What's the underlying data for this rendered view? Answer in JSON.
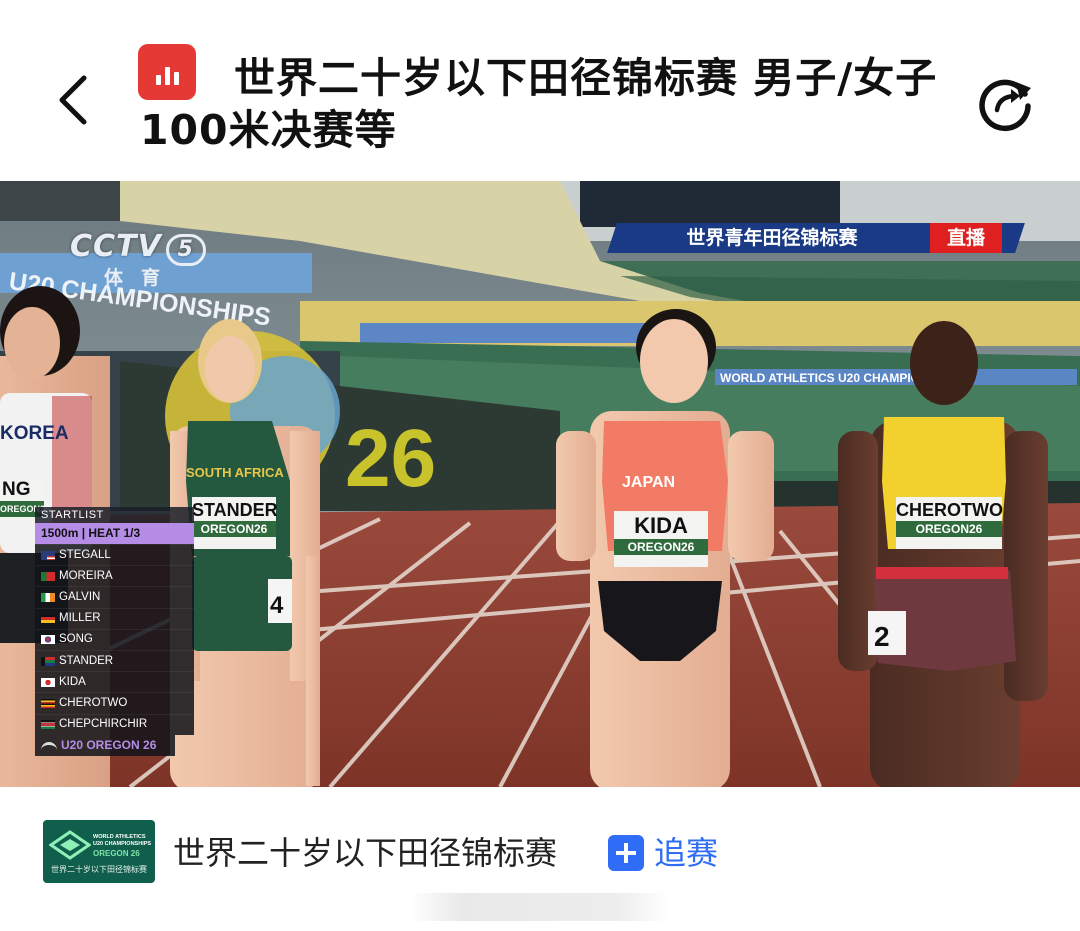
{
  "header": {
    "back_icon": "chevron-left-icon",
    "app_icon": "bar-chart-icon",
    "app_icon_color": "#e53935",
    "title": "世界二十岁以下田径锦标赛 男子/女子100米决赛等",
    "refresh_icon": "refresh-icon"
  },
  "video": {
    "broadcaster_logo": "CCTV",
    "channel_number": "5",
    "channel_name": "体育",
    "banner_text": "世界青年田径锦标赛",
    "live_badge": "直播",
    "banner_color": "#1a3a86",
    "live_color": "#e02020",
    "stadium_sign_left": "U20 CHAMPIONSHIPS",
    "stadium_sign_right": "WORLD ATHLETICS U20 CHAMPIONSHIPS",
    "stadium_number": "26",
    "athletes": [
      {
        "bib_name": "NG",
        "bib_sub": "OREGON26",
        "shirt_text": "KOREA"
      },
      {
        "bib_name": "STANDER",
        "bib_sub": "OREGON26",
        "shirt_text": "SOUTH AFRICA"
      },
      {
        "bib_name": "KIDA",
        "bib_sub": "OREGON26",
        "shirt_text": "JAPAN"
      },
      {
        "bib_name": "CHEROTWO",
        "bib_sub": "OREGON26",
        "shirt_text": ""
      }
    ],
    "hip_numbers": [
      "4",
      "2"
    ],
    "startlist": {
      "header": "STARTLIST",
      "heat": "1500m | HEAT 1/3",
      "entries": [
        {
          "name": "STEGALL",
          "flag": "usa"
        },
        {
          "name": "MOREIRA",
          "flag": "portugal"
        },
        {
          "name": "GALVIN",
          "flag": "ireland"
        },
        {
          "name": "MILLER",
          "flag": "germany"
        },
        {
          "name": "SONG",
          "flag": "south-korea"
        },
        {
          "name": "STANDER",
          "flag": "south-africa"
        },
        {
          "name": "KIDA",
          "flag": "japan"
        },
        {
          "name": "CHEROTWO",
          "flag": "uganda"
        },
        {
          "name": "CHEPCHIRCHIR",
          "flag": "kenya"
        }
      ],
      "footer": "U20 OREGON 26",
      "accent_color": "#b58de6"
    }
  },
  "bottom": {
    "logo_lines": [
      "WORLD ATHLETICS",
      "U20 CHAMPIONSHIPS",
      "OREGON 26",
      "世界二十岁以下田径锦标赛"
    ],
    "league_name": "世界二十岁以下田径锦标赛",
    "follow_label": "追赛",
    "follow_color": "#2f6df6"
  }
}
